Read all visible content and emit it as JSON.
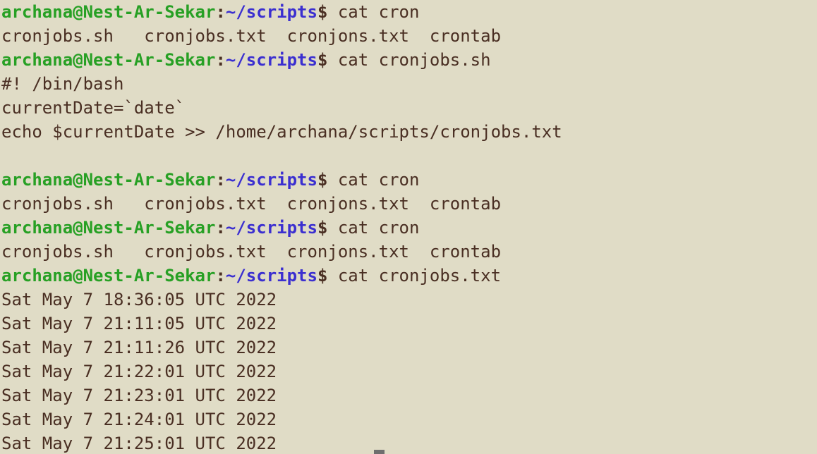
{
  "prompt": {
    "user_host": "archana@Nest-Ar-Sekar",
    "separator": ":",
    "path": "~/scripts",
    "symbol": "$ "
  },
  "lines": [
    {
      "type": "prompt",
      "command": "cat cron"
    },
    {
      "type": "output",
      "text": "cronjobs.sh   cronjobs.txt  cronjons.txt  crontab"
    },
    {
      "type": "prompt",
      "command": "cat cronjobs.sh"
    },
    {
      "type": "output",
      "text": "#! /bin/bash"
    },
    {
      "type": "output",
      "text": "currentDate=`date`"
    },
    {
      "type": "output",
      "text": "echo $currentDate >> /home/archana/scripts/cronjobs.txt"
    },
    {
      "type": "output",
      "text": ""
    },
    {
      "type": "prompt",
      "command": "cat cron"
    },
    {
      "type": "output",
      "text": "cronjobs.sh   cronjobs.txt  cronjons.txt  crontab"
    },
    {
      "type": "prompt",
      "command": "cat cron"
    },
    {
      "type": "output",
      "text": "cronjobs.sh   cronjobs.txt  cronjons.txt  crontab"
    },
    {
      "type": "prompt",
      "command": "cat cronjobs.txt"
    },
    {
      "type": "output",
      "text": "Sat May 7 18:36:05 UTC 2022"
    },
    {
      "type": "output",
      "text": "Sat May 7 21:11:05 UTC 2022"
    },
    {
      "type": "output",
      "text": "Sat May 7 21:11:26 UTC 2022"
    },
    {
      "type": "output",
      "text": "Sat May 7 21:22:01 UTC 2022"
    },
    {
      "type": "output",
      "text": "Sat May 7 21:23:01 UTC 2022"
    },
    {
      "type": "output",
      "text": "Sat May 7 21:24:01 UTC 2022"
    },
    {
      "type": "output",
      "text": "Sat May 7 21:25:01 UTC 2022"
    }
  ]
}
